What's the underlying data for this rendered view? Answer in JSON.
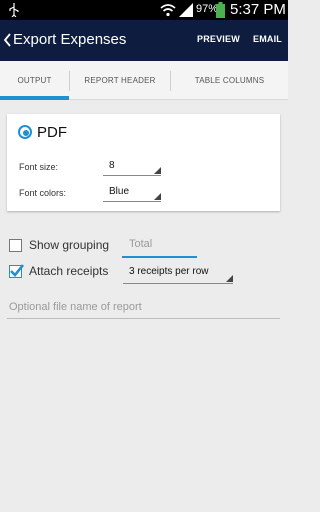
{
  "status_bar": {
    "battery_percent": "97%",
    "time": "5:37 PM"
  },
  "action_bar": {
    "title": "Export Expenses",
    "preview_label": "PREVIEW",
    "email_label": "EMAIL"
  },
  "tabs": [
    {
      "label": "OUTPUT",
      "selected": true
    },
    {
      "label": "REPORT HEADER",
      "selected": false
    },
    {
      "label": "TABLE COLUMNS",
      "selected": false
    }
  ],
  "pdf_card": {
    "format_label": "PDF",
    "format_selected": true,
    "font_size_label": "Font size:",
    "font_size_value": "8",
    "font_colors_label": "Font colors:",
    "font_colors_value": "Blue"
  },
  "options": {
    "show_grouping_label": "Show grouping",
    "show_grouping_checked": false,
    "grouping_placeholder": "Total",
    "attach_receipts_label": "Attach receipts",
    "attach_receipts_checked": true,
    "receipts_per_row_value": "3 receipts per row",
    "filename_placeholder": "Optional file name of report"
  },
  "colors": {
    "accent": "#1e90d6",
    "action_bar": "#0e1c3f",
    "background": "#ececec"
  }
}
